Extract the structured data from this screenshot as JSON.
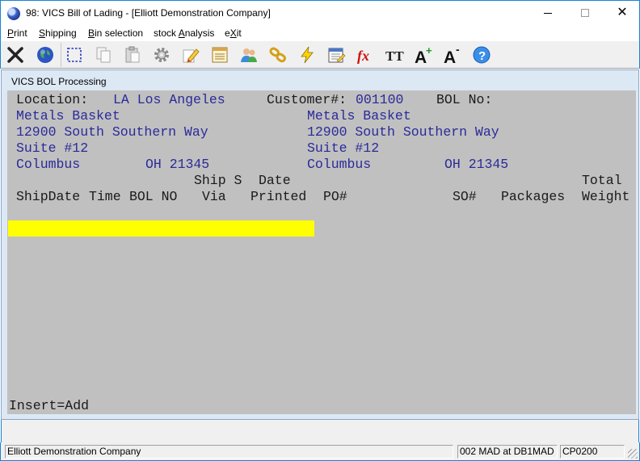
{
  "window": {
    "title": "98: VICS Bill of Lading - [Elliott Demonstration Company]",
    "close_glyph": "✕"
  },
  "menu": [
    {
      "prefix": "",
      "key": "P",
      "rest": "rint"
    },
    {
      "prefix": "",
      "key": "S",
      "rest": "hipping"
    },
    {
      "prefix": "",
      "key": "B",
      "rest": "in selection"
    },
    {
      "prefix": "stock ",
      "key": "A",
      "rest": "nalysis"
    },
    {
      "prefix": "e",
      "key": "X",
      "rest": "it"
    }
  ],
  "toolbar_icons": [
    "close-x-icon",
    "globe-icon",
    "select-rectangle-icon",
    "copy-icon",
    "paste-icon",
    "settings-gear-icon",
    "edit-pencil-icon",
    "notes-icon",
    "users-icon",
    "chain-link-icon",
    "lightning-icon",
    "calendar-edit-icon",
    "function-fx-icon",
    "font-tt-icon",
    "font-increase-icon",
    "font-decrease-icon",
    "help-icon"
  ],
  "toolbar_glyphs": {
    "fx": "fx",
    "tt": "TT",
    "a_big": "A",
    "plus": "+",
    "minus": "-",
    "help": "?"
  },
  "inner": {
    "title": "VICS BOL Processing"
  },
  "screen": {
    "location_label": "Location:",
    "location_value": "LA Los Angeles",
    "customer_label": "Customer#:",
    "customer_value": "001100",
    "bol_label": "BOL No:",
    "bill_to": {
      "name": "Metals Basket",
      "addr1": "12900 South Southern Way",
      "addr2": "Suite #12",
      "city": "Columbus",
      "state_zip": "OH 21345"
    },
    "ship_to": {
      "name": "Metals Basket",
      "addr1": "12900 South Southern Way",
      "addr2": "Suite #12",
      "city": "Columbus",
      "state_zip": "OH 21345"
    },
    "header_row1": {
      "ship_s": "Ship S",
      "date": "Date",
      "total": "Total"
    },
    "header_row2": {
      "shipdate": "ShipDate",
      "time": "Time",
      "bol_no": "BOL NO",
      "via": "Via",
      "printed": "Printed",
      "po": "PO#",
      "so": "SO#",
      "packages": "Packages",
      "weight": "Weight"
    },
    "footer_hint": "Insert=Add"
  },
  "status": {
    "company": "Elliott Demonstration Company",
    "session": "002 MAD at DB1MAD",
    "program": "CP0200"
  }
}
